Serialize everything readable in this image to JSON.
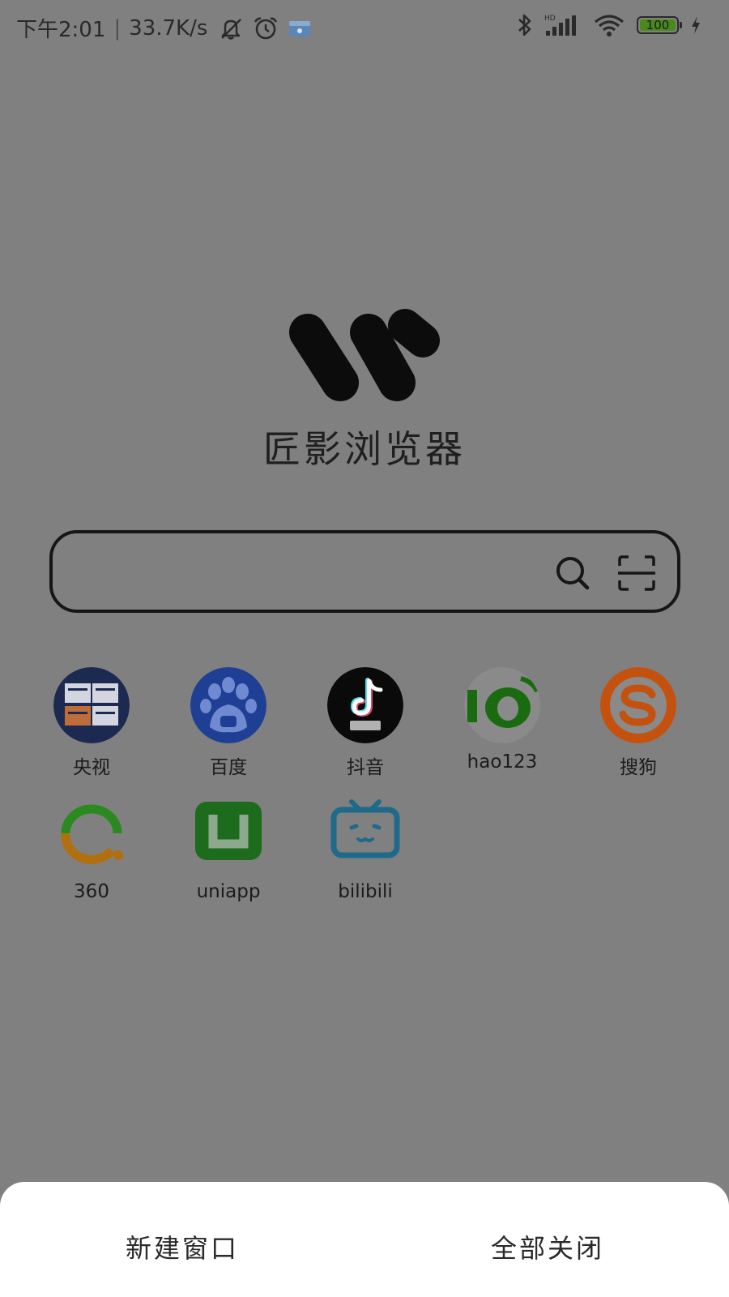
{
  "status_bar": {
    "time": "下午2:01",
    "separator": "|",
    "network_speed": "33.7K/s",
    "battery_level": "100",
    "icons_left": [
      "mute-bell-icon",
      "alarm-icon",
      "wallet-icon"
    ],
    "icons_right": [
      "bluetooth-icon",
      "hd-signal-icon",
      "wifi-icon",
      "battery-icon",
      "charging-icon"
    ]
  },
  "app": {
    "title": "匠影浏览器",
    "logo": "w-logo"
  },
  "search": {
    "value": "",
    "placeholder": "",
    "search_icon": "search-icon",
    "scan_icon": "scan-icon"
  },
  "shortcuts": [
    {
      "label": "央视",
      "icon": "cctv-news-icon"
    },
    {
      "label": "百度",
      "icon": "baidu-icon"
    },
    {
      "label": "抖音",
      "icon": "douyin-icon"
    },
    {
      "label": "hao123",
      "icon": "hao123-icon"
    },
    {
      "label": "搜狗",
      "icon": "sogou-icon"
    },
    {
      "label": "360",
      "icon": "360-icon"
    },
    {
      "label": "uniapp",
      "icon": "uniapp-icon"
    },
    {
      "label": "bilibili",
      "icon": "bilibili-icon"
    }
  ],
  "bottom_sheet": {
    "new_window": "新建窗口",
    "close_all": "全部关闭"
  },
  "colors": {
    "overlay_background": "#808080",
    "sheet_background": "#ffffff",
    "text_dark": "#1b1b1b"
  }
}
